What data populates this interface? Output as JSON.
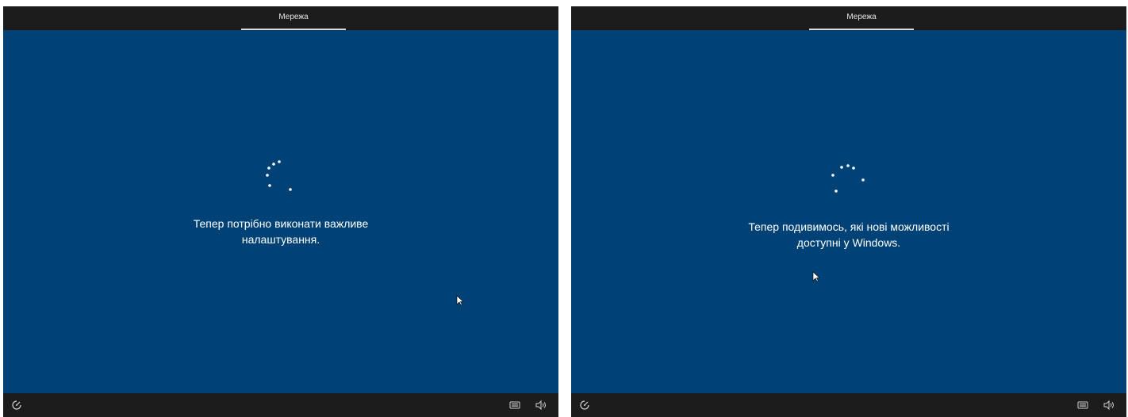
{
  "screens": [
    {
      "tab_label": "Мережа",
      "message_line1": "Тепер потрібно виконати важливе",
      "message_line2": "налаштування."
    },
    {
      "tab_label": "Мережа",
      "message_line1": "Тепер подивимось, які нові можливості",
      "message_line2": "доступні у Windows."
    }
  ],
  "icons": {
    "ease_of_access": "ease-of-access-icon",
    "keyboard": "keyboard-icon",
    "volume": "volume-icon",
    "cursor": "mouse-cursor-icon",
    "spinner": "loading-spinner-icon"
  },
  "colors": {
    "background": "#004275",
    "bar": "#1c1c1c",
    "text": "#ffffff"
  }
}
